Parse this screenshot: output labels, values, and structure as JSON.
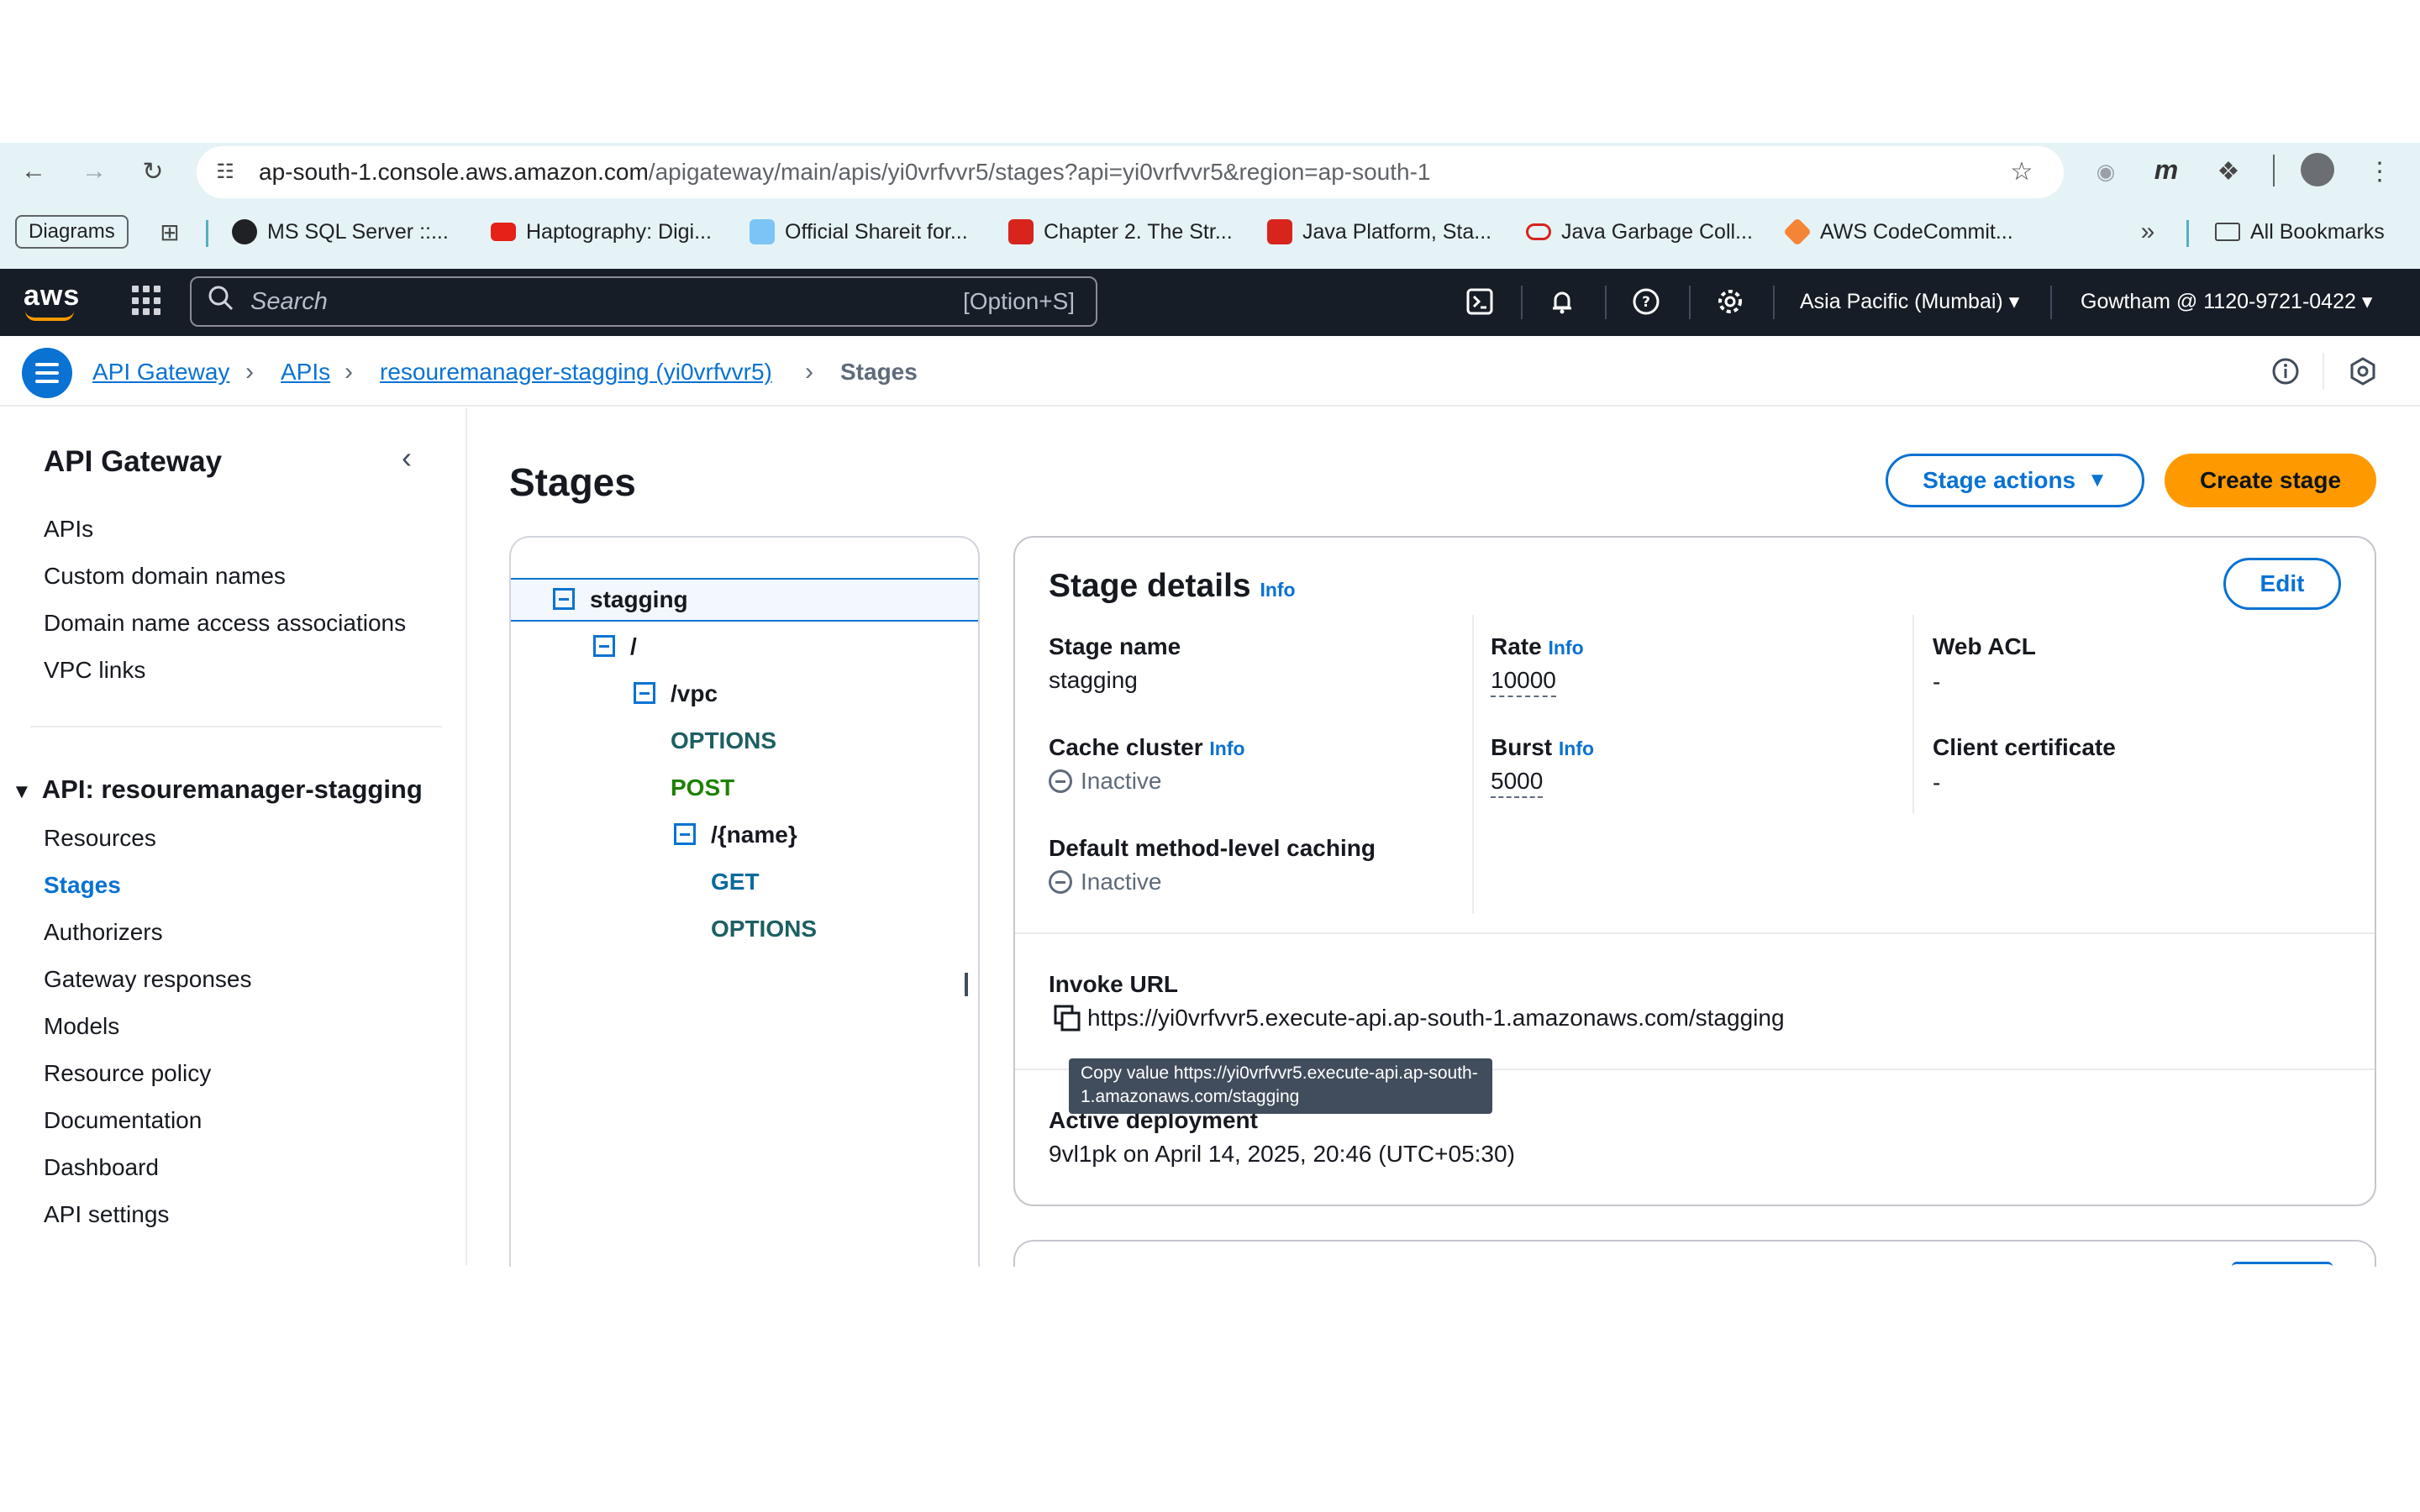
{
  "browser": {
    "url_host": "ap-south-1.console.aws.amazon.com",
    "url_path": "/apigateway/main/apis/yi0vrfvvr5/stages?api=yi0vrfvvr5&region=ap-south-1",
    "bookmarks": [
      {
        "label": "Diagrams",
        "icon": "chip"
      },
      {
        "label": "MS SQL Server ::...",
        "icon": "globe-icon",
        "color": "#202124"
      },
      {
        "label": "Haptography: Digi...",
        "icon": "youtube-icon",
        "color": "#e62117"
      },
      {
        "label": "Official Shareit for...",
        "icon": "shareit-icon",
        "color": "#4aa3f0"
      },
      {
        "label": "Chapter 2. The Str...",
        "icon": "oracle-icon",
        "color": "#d7241d"
      },
      {
        "label": "Java Platform, Sta...",
        "icon": "oracle-icon",
        "color": "#d7241d"
      },
      {
        "label": "Java Garbage Coll...",
        "icon": "oracle-ring-icon",
        "color": "#d7241d"
      },
      {
        "label": "AWS CodeCommit...",
        "icon": "aws-cube-icon",
        "color": "#f58536"
      }
    ],
    "all_bookmarks": "All Bookmarks"
  },
  "aws_nav": {
    "logo": "aws",
    "search_placeholder": "Search",
    "search_shortcut": "[Option+S]",
    "region": "Asia Pacific (Mumbai)",
    "account": "Gowtham @ 1120-9721-0422"
  },
  "breadcrumb": {
    "items": [
      "API Gateway",
      "APIs",
      "resouremanager-stagging (yi0vrfvvr5)"
    ],
    "current": "Stages"
  },
  "sidebar": {
    "title": "API Gateway",
    "top_links": [
      "APIs",
      "Custom domain names",
      "Domain name access associations",
      "VPC links"
    ],
    "api_section": "API: resouremanager-stagging",
    "api_links": [
      "Resources",
      "Stages",
      "Authorizers",
      "Gateway responses",
      "Models",
      "Resource policy",
      "Documentation",
      "Dashboard",
      "API settings"
    ],
    "active": "Stages"
  },
  "main": {
    "title": "Stages",
    "stage_actions": "Stage actions",
    "create_stage": "Create stage"
  },
  "tree": {
    "stage": "stagging",
    "root": "/",
    "vpc": "/vpc",
    "vpc_methods": [
      "OPTIONS",
      "POST"
    ],
    "name": "/{name}",
    "name_methods": [
      "GET",
      "OPTIONS"
    ]
  },
  "details": {
    "title": "Stage details",
    "info": "Info",
    "edit": "Edit",
    "stage_name_label": "Stage name",
    "stage_name": "stagging",
    "rate_label": "Rate",
    "rate": "10000",
    "web_acl_label": "Web ACL",
    "web_acl": "-",
    "cache_cluster_label": "Cache cluster",
    "cache_cluster": "Inactive",
    "burst_label": "Burst",
    "burst": "5000",
    "client_cert_label": "Client certificate",
    "client_cert": "-",
    "default_caching_label": "Default method-level caching",
    "default_caching": "Inactive",
    "invoke_url_label": "Invoke URL",
    "invoke_url": "https://yi0vrfvvr5.execute-api.ap-south-1.amazonaws.com/stagging",
    "tooltip": "Copy value https://yi0vrfvvr5.execute-api.ap-south-1.amazonaws.com/stagging",
    "active_deployment_label": "Active deployment",
    "active_deployment": "9vl1pk on April 14, 2025, 20:46 (UTC+05:30)"
  }
}
